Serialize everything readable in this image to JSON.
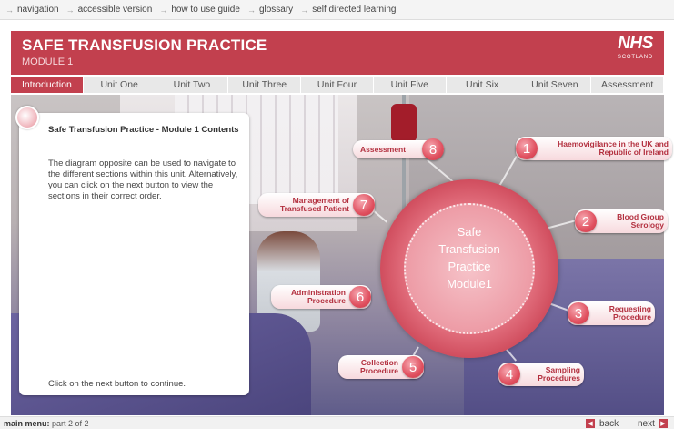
{
  "topbar": {
    "items": [
      "navigation",
      "accessible version",
      "how to use guide",
      "glossary",
      "self directed learning"
    ]
  },
  "header": {
    "title": "SAFE TRANSFUSION PRACTICE",
    "subtitle": "MODULE 1",
    "logo_main": "NHS",
    "logo_sub": "SCOTLAND"
  },
  "tabs": [
    {
      "label": "Introduction",
      "active": true
    },
    {
      "label": "Unit One",
      "active": false
    },
    {
      "label": "Unit Two",
      "active": false
    },
    {
      "label": "Unit Three",
      "active": false
    },
    {
      "label": "Unit Four",
      "active": false
    },
    {
      "label": "Unit Five",
      "active": false
    },
    {
      "label": "Unit Six",
      "active": false
    },
    {
      "label": "Unit Seven",
      "active": false
    },
    {
      "label": "Assessment",
      "active": false
    }
  ],
  "panel": {
    "title": "Safe Transfusion Practice - Module 1 Contents",
    "body": "The diagram opposite can be used to navigate to the different sections within this unit. Alternatively, you can click on the next button to view the sections in their correct order.",
    "footer": "Click on the next button to continue."
  },
  "hub": {
    "line1": "Safe",
    "line2": "Transfusion",
    "line3": "Practice",
    "line4": "Module1"
  },
  "nodes": {
    "n1": {
      "num": "1",
      "label": "Haemovigilance in the UK and Republic of Ireland"
    },
    "n2": {
      "num": "2",
      "label": "Blood Group Serology"
    },
    "n3": {
      "num": "3",
      "label": "Requesting Procedure"
    },
    "n4": {
      "num": "4",
      "label": "Sampling Procedures"
    },
    "n5": {
      "num": "5",
      "label": "Collection Procedure"
    },
    "n6": {
      "num": "6",
      "label": "Administration Procedure"
    },
    "n7": {
      "num": "7",
      "label": "Management of Transfused Patient"
    },
    "n8": {
      "num": "8",
      "label": "Assessment"
    }
  },
  "footer": {
    "menu_bold": "main menu:",
    "menu_part": " part 2 of 2",
    "back": "back",
    "next": "next"
  },
  "colors": {
    "brand": "#c2404e",
    "node_text": "#b3303f"
  }
}
